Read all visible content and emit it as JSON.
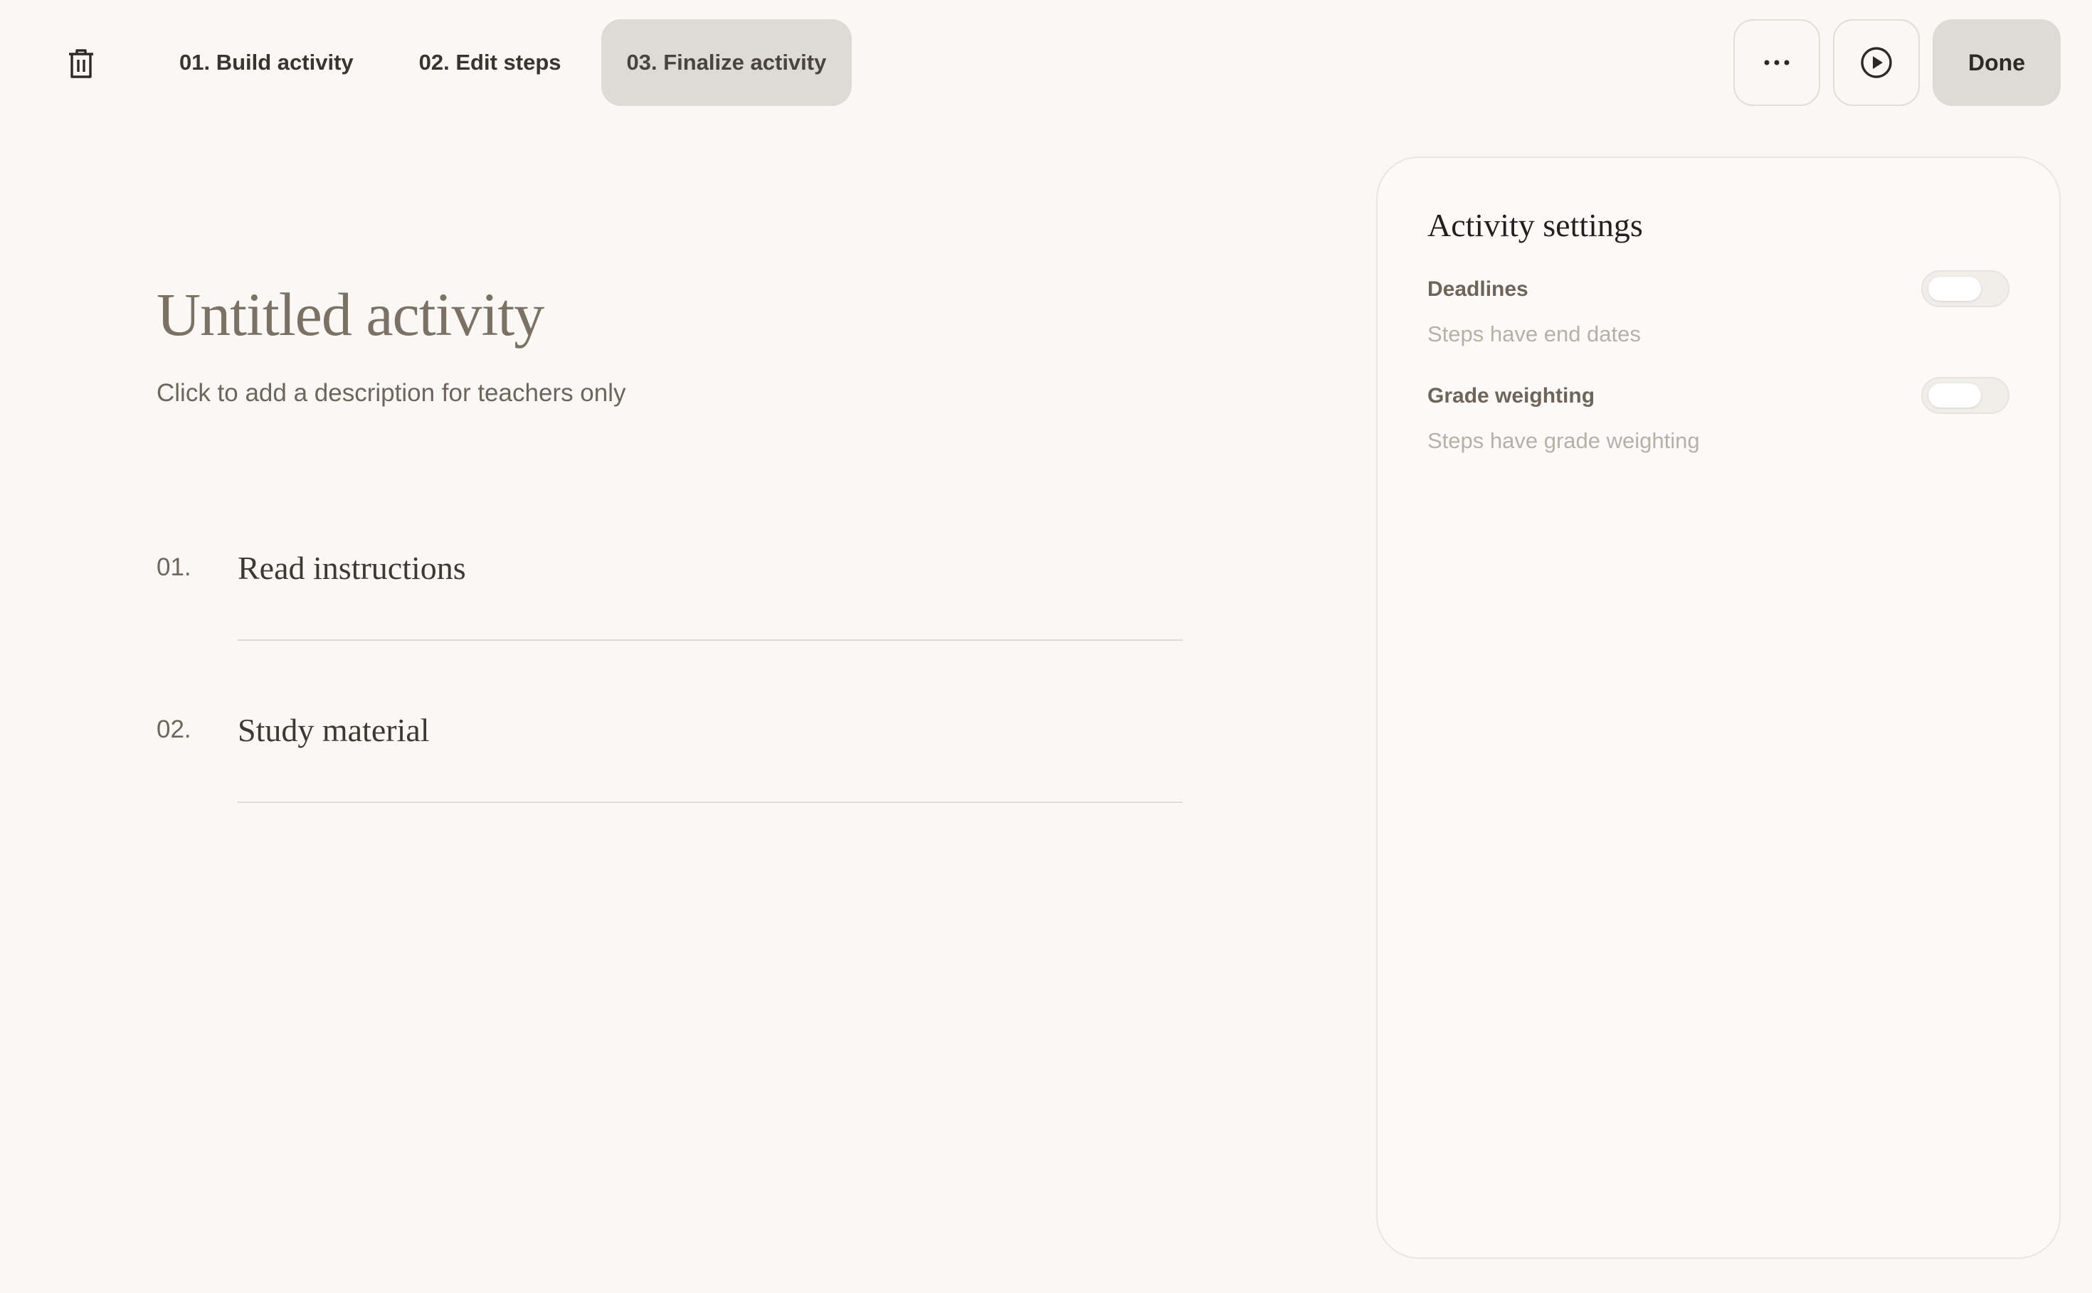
{
  "toolbar": {
    "delete_icon": "trash-icon",
    "tabs": [
      {
        "label": "01. Build activity",
        "active": false
      },
      {
        "label": "02. Edit steps",
        "active": false
      },
      {
        "label": "03. Finalize activity",
        "active": true
      }
    ],
    "more_icon": "ellipsis-icon",
    "preview_icon": "play-circle-icon",
    "done_label": "Done"
  },
  "activity": {
    "title": "Untitled activity",
    "description_placeholder": "Click to add a description for teachers only",
    "steps": [
      {
        "number": "01.",
        "title": "Read instructions"
      },
      {
        "number": "02.",
        "title": "Study material"
      }
    ]
  },
  "settings": {
    "title": "Activity settings",
    "items": [
      {
        "label": "Deadlines",
        "description": "Steps have end dates",
        "enabled": false
      },
      {
        "label": "Grade weighting",
        "description": "Steps have grade weighting",
        "enabled": false
      }
    ]
  },
  "colors": {
    "background": "#faf7f4",
    "active_tab": "#dedad6",
    "title": "#7b7164"
  }
}
